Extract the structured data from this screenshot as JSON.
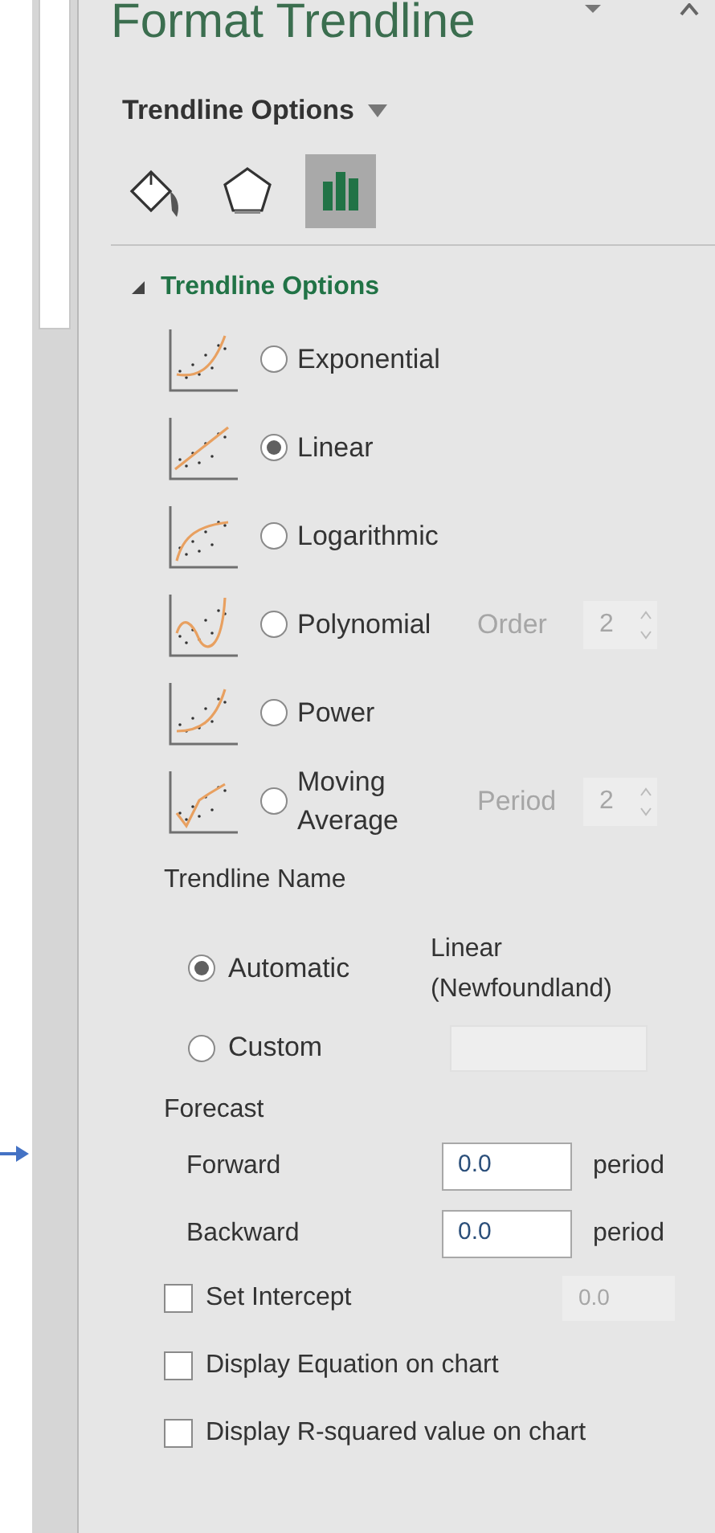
{
  "panel": {
    "title": "Format Trendline",
    "options_menu": "Trendline Options"
  },
  "tabs": [
    {
      "kind": "fill",
      "selected": false
    },
    {
      "kind": "effects",
      "selected": false
    },
    {
      "kind": "options",
      "selected": true
    }
  ],
  "section": {
    "title": "Trendline Options",
    "expanded": true
  },
  "trend_types": [
    {
      "kind": "exponential",
      "label": "Exponential",
      "selected": false
    },
    {
      "kind": "linear",
      "label": "Linear",
      "selected": true
    },
    {
      "kind": "logarithmic",
      "label": "Logarithmic",
      "selected": false
    },
    {
      "kind": "polynomial",
      "label": "Polynomial",
      "selected": false,
      "spinner": {
        "label": "Order",
        "value": "2",
        "disabled": true
      }
    },
    {
      "kind": "power",
      "label": "Power",
      "selected": false
    },
    {
      "kind": "moving_average",
      "label": "Moving Average",
      "selected": false,
      "spinner": {
        "label": "Period",
        "value": "2",
        "disabled": true
      }
    }
  ],
  "trendline_name": {
    "label": "Trendline Name",
    "options": [
      {
        "label": "Automatic",
        "selected": true,
        "value": "Linear (Newfoundland)"
      },
      {
        "label": "Custom",
        "selected": false
      }
    ]
  },
  "forecast": {
    "label": "Forecast",
    "fields": [
      {
        "label": "Forward",
        "value": "0.0",
        "unit": "period"
      },
      {
        "label": "Backward",
        "value": "0.0",
        "unit": "period"
      }
    ]
  },
  "checkboxes": [
    {
      "label": "Set Intercept",
      "checked": false,
      "value": "0.0"
    },
    {
      "label": "Display Equation on chart",
      "checked": false
    },
    {
      "label": "Display R-squared value on chart",
      "checked": false
    }
  ]
}
